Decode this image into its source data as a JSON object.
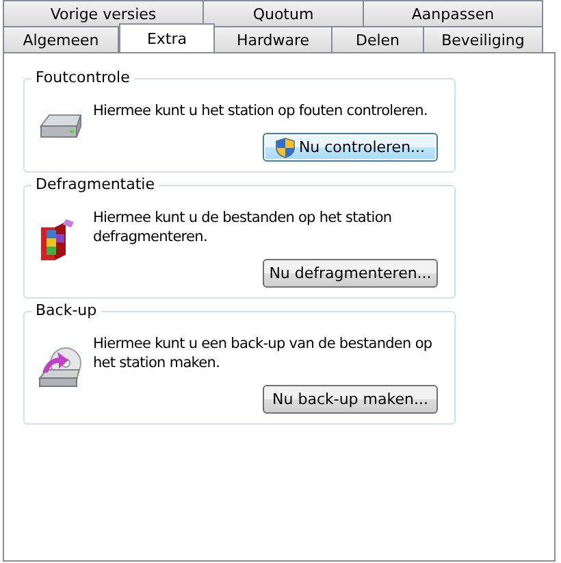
{
  "tab_rows": [
    {
      "tabs": [
        {
          "label": "Vorige versies",
          "selected": false
        },
        {
          "label": "Quotum",
          "selected": false
        },
        {
          "label": "Aanpassen",
          "selected": false
        }
      ]
    },
    {
      "tabs": [
        {
          "label": "Algemeen",
          "selected": false
        },
        {
          "label": "Extra",
          "selected": true
        },
        {
          "label": "Hardware",
          "selected": false
        },
        {
          "label": "Delen",
          "selected": false
        },
        {
          "label": "Beveiliging",
          "selected": false
        }
      ]
    }
  ],
  "sections": [
    {
      "title": "Foutcontrole",
      "kind": "drive",
      "description": "Hiermee kunt u het station op fouten controleren.",
      "button": {
        "label": "Nu controleren...",
        "shield": true,
        "focused": true
      }
    },
    {
      "title": "Defragmentatie",
      "kind": "defrag",
      "description": "Hiermee kunt u de bestanden op het station defragmenteren.",
      "button": {
        "label": "Nu defragmenteren...",
        "shield": false,
        "focused": false
      }
    },
    {
      "title": "Back-up",
      "kind": "backup",
      "description": "Hiermee kunt u een back-up van de bestanden op het station maken.",
      "button": {
        "label": "Nu back-up maken...",
        "shield": false,
        "focused": false
      }
    }
  ]
}
